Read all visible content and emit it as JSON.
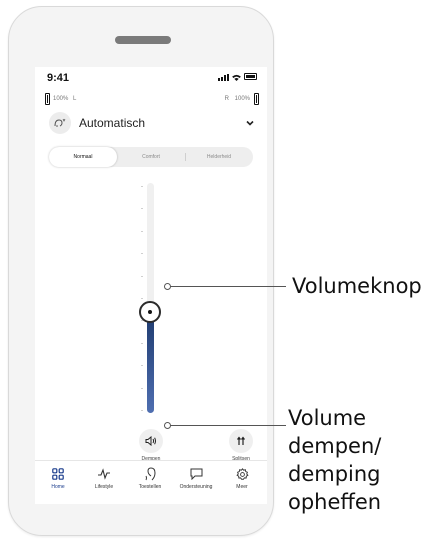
{
  "status_bar": {
    "time": "9:41"
  },
  "battery": {
    "left_percent": "100%",
    "left_side": "L",
    "right_side": "R",
    "right_percent": "100%"
  },
  "program": {
    "name": "Automatisch",
    "icon": "auto-program-icon"
  },
  "modes": {
    "items": [
      "Normaal",
      "Comfort",
      "Helderheid"
    ],
    "selected": "Normaal"
  },
  "volume": {
    "level": 0.44
  },
  "controls": {
    "mute_label": "Dempen",
    "split_label": "Splitsen"
  },
  "tabs": [
    {
      "label": "Home",
      "icon": "home-grid-icon",
      "active": true
    },
    {
      "label": "Lifestyle",
      "icon": "activity-icon",
      "active": false
    },
    {
      "label": "Toestellen",
      "icon": "hearing-aid-icon",
      "active": false
    },
    {
      "label": "Ondersteuning",
      "icon": "chat-bubble-icon",
      "active": false
    },
    {
      "label": "Meer",
      "icon": "gear-icon",
      "active": false
    }
  ],
  "callouts": {
    "volume_knob": "Volumeknop",
    "mute_lines": [
      "Volume",
      "dempen/",
      "demping",
      "opheffen"
    ]
  },
  "colors": {
    "accent": "#1a3c8c",
    "slider_fill_top": "#1e3a6e",
    "slider_fill_bottom": "#4f6fb1"
  }
}
